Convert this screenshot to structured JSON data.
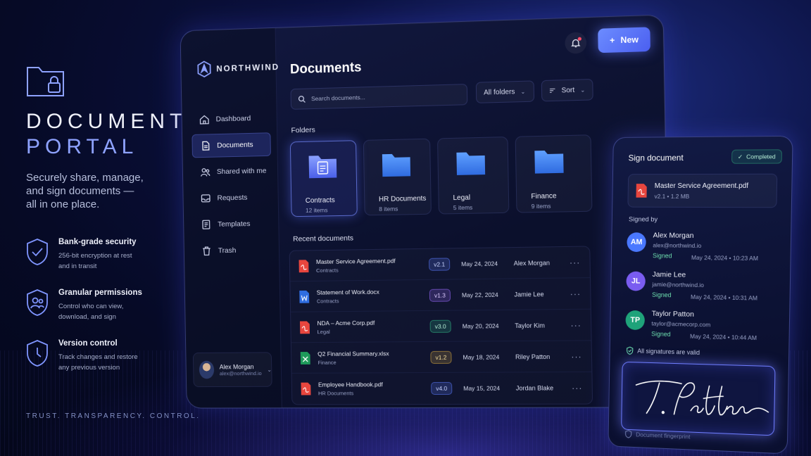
{
  "hero": {
    "title_line1": "DOCUMENT",
    "title_line2": "PORTAL",
    "subtitle": "Securely share, manage, and sign documents — all in one place."
  },
  "features": [
    {
      "icon": "shield-check-icon",
      "title": "Bank-grade security",
      "desc": "256-bit encryption at rest and in transit"
    },
    {
      "icon": "shield-users-icon",
      "title": "Granular permissions",
      "desc": "Control who can view, download, and sign"
    },
    {
      "icon": "shield-clock-icon",
      "title": "Version control",
      "desc": "Track changes and restore any previous version"
    }
  ],
  "tagline": "TRUST. TRANSPARENCY. CONTROL.",
  "app": {
    "brand": "NORTHWIND",
    "nav": [
      {
        "label": "Dashboard",
        "icon": "home-icon",
        "active": false
      },
      {
        "label": "Documents",
        "icon": "document-icon",
        "active": true
      },
      {
        "label": "Shared with me",
        "icon": "users-icon",
        "active": false
      },
      {
        "label": "Requests",
        "icon": "inbox-icon",
        "active": false
      },
      {
        "label": "Templates",
        "icon": "template-icon",
        "active": false
      },
      {
        "label": "Trash",
        "icon": "trash-icon",
        "active": false
      }
    ],
    "user": {
      "name": "Alex Morgan",
      "email": "alex@northwind.io"
    },
    "page_title": "Documents",
    "new_label": "New",
    "search_placeholder": "Search documents...",
    "filter_label": "All folders",
    "sort_label": "Sort",
    "folders_label": "Folders",
    "folders": [
      {
        "name": "Contracts",
        "count": "12 items",
        "active": true
      },
      {
        "name": "HR Documents",
        "count": "8 items",
        "active": false
      },
      {
        "name": "Legal",
        "count": "5 items",
        "active": false
      },
      {
        "name": "Finance",
        "count": "9 items",
        "active": false
      }
    ],
    "recent_label": "Recent documents",
    "documents": [
      {
        "name": "Master Service Agreement.pdf",
        "folder": "Contracts",
        "version": "v2.1",
        "date": "May 24, 2024",
        "owner": "Alex Morgan",
        "type": "pdf",
        "version_color": "#5b7bff"
      },
      {
        "name": "Statement of Work.docx",
        "folder": "Contracts",
        "version": "v1.3",
        "date": "May 22, 2024",
        "owner": "Jamie Lee",
        "type": "docx",
        "version_color": "#9b6bff"
      },
      {
        "name": "NDA – Acme Corp.pdf",
        "folder": "Legal",
        "version": "v3.0",
        "date": "May 20, 2024",
        "owner": "Taylor Kim",
        "type": "pdf",
        "version_color": "#34c08a"
      },
      {
        "name": "Q2 Financial Summary.xlsx",
        "folder": "Finance",
        "version": "v1.2",
        "date": "May 18, 2024",
        "owner": "Riley Patton",
        "type": "xlsx",
        "version_color": "#e0b040"
      },
      {
        "name": "Employee Handbook.pdf",
        "folder": "HR Documents",
        "version": "v4.0",
        "date": "May 15, 2024",
        "owner": "Jordan Blake",
        "type": "pdf",
        "version_color": "#5b7bff"
      }
    ],
    "row_menu": "···"
  },
  "sign": {
    "title": "Sign document",
    "status": "Completed",
    "file_name": "Master Service Agreement.pdf",
    "file_meta": "v2.1  •  1.2 MB",
    "signed_by_label": "Signed by",
    "signers": [
      {
        "initials": "AM",
        "name": "Alex Morgan",
        "email": "alex@northwind.io",
        "status": "Signed",
        "time": "May 24, 2024  •  10:23 AM",
        "color": "#4a78ff"
      },
      {
        "initials": "JL",
        "name": "Jamie Lee",
        "email": "jamie@northwind.io",
        "status": "Signed",
        "time": "May 24, 2024  •  10:31 AM",
        "color": "#7a5cf0"
      },
      {
        "initials": "TP",
        "name": "Taylor Patton",
        "email": "taylor@acmecorp.com",
        "status": "Signed",
        "time": "May 24, 2024  •  10:44 AM",
        "color": "#1fa37a"
      }
    ],
    "valid_label": "All signatures are valid",
    "signature": "T. Patton",
    "footer_label": "Document fingerprint"
  },
  "colors": {
    "accent": "#5b6dff",
    "success": "#34c08a",
    "bg": "#060a26"
  }
}
